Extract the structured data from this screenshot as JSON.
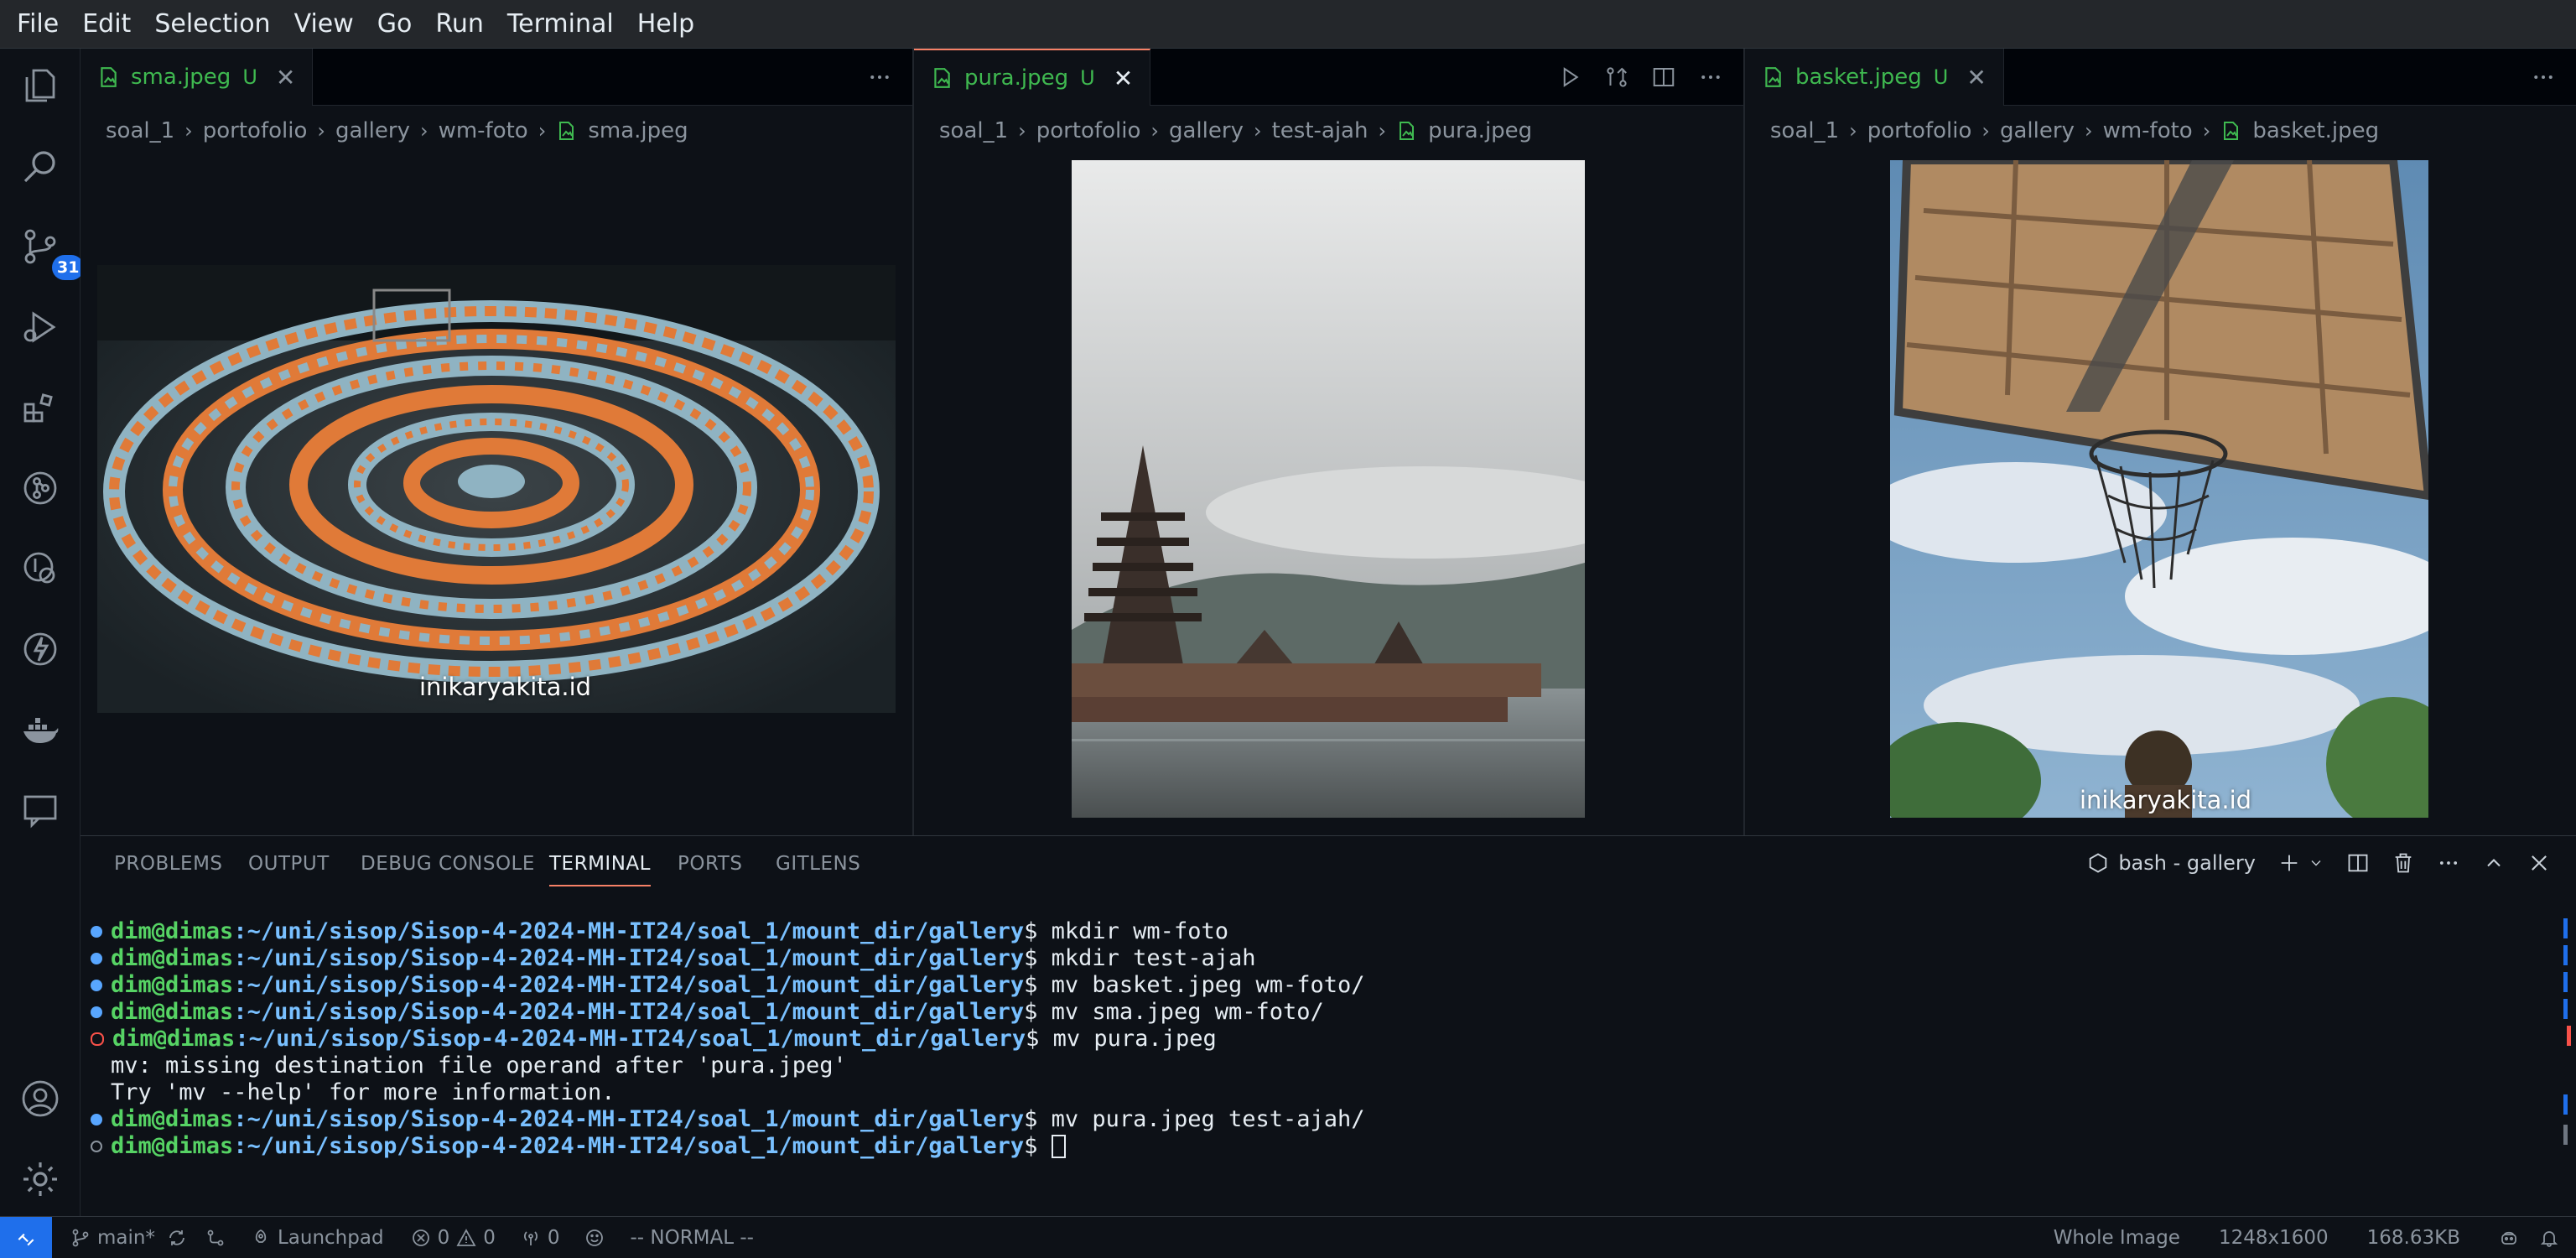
{
  "menu": [
    "File",
    "Edit",
    "Selection",
    "View",
    "Go",
    "Run",
    "Terminal",
    "Help"
  ],
  "activity": {
    "source_control_badge": "31"
  },
  "groups": [
    {
      "tab": {
        "name": "sma.jpeg",
        "status": "U",
        "close": "✕"
      },
      "breadcrumb": [
        "soal_1",
        "portofolio",
        "gallery",
        "wm-foto",
        "sma.jpeg"
      ],
      "image": {
        "watermark": "inikaryakita.id",
        "description": "aerial photo of students in orange and light blue uniforms forming a spiral"
      }
    },
    {
      "tab": {
        "name": "pura.jpeg",
        "status": "U",
        "close": "✕"
      },
      "breadcrumb": [
        "soal_1",
        "portofolio",
        "gallery",
        "test-ajah",
        "pura.jpeg"
      ],
      "image": {
        "description": "Balinese temple pagodas by a lake under cloudy sky"
      }
    },
    {
      "tab": {
        "name": "basket.jpeg",
        "status": "U",
        "close": "✕"
      },
      "breadcrumb": [
        "soal_1",
        "portofolio",
        "gallery",
        "wm-foto",
        "basket.jpeg"
      ],
      "image": {
        "watermark": "inikaryakita.id",
        "description": "basketball backboard and net seen from below against blue sky"
      }
    }
  ],
  "panel": {
    "tabs": [
      "PROBLEMS",
      "OUTPUT",
      "DEBUG CONSOLE",
      "TERMINAL",
      "PORTS",
      "GITLENS"
    ],
    "active_tab": "TERMINAL",
    "terminal_name": "bash - gallery"
  },
  "terminal": {
    "prompt_user": "dim@dimas",
    "prompt_path": ":~/uni/sisop/Sisop-4-2024-MH-IT24/soal_1/mount_dir/gallery",
    "prompt_symbol": "$ ",
    "lines": [
      {
        "cmd": "mkdir wm-foto"
      },
      {
        "cmd": "mkdir test-ajah"
      },
      {
        "cmd": "mv basket.jpeg wm-foto/"
      },
      {
        "cmd": "mv sma.jpeg wm-foto/"
      },
      {
        "cmd": "mv pura.jpeg"
      },
      {
        "output": "mv: missing destination file operand after 'pura.jpeg'"
      },
      {
        "output": "Try 'mv --help' for more information."
      },
      {
        "cmd": "mv pura.jpeg test-ajah/"
      }
    ]
  },
  "statusbar": {
    "branch": "main*",
    "launchpad": "Launchpad",
    "errors": "0",
    "warnings": "0",
    "ports": "0",
    "mode": "-- NORMAL --",
    "view_mode": "Whole Image",
    "dimensions": "1248x1600",
    "file_size": "168.63KB"
  },
  "colors": {
    "accent": "#f78166",
    "added": "#3fb950",
    "badge": "#1f6feb"
  }
}
